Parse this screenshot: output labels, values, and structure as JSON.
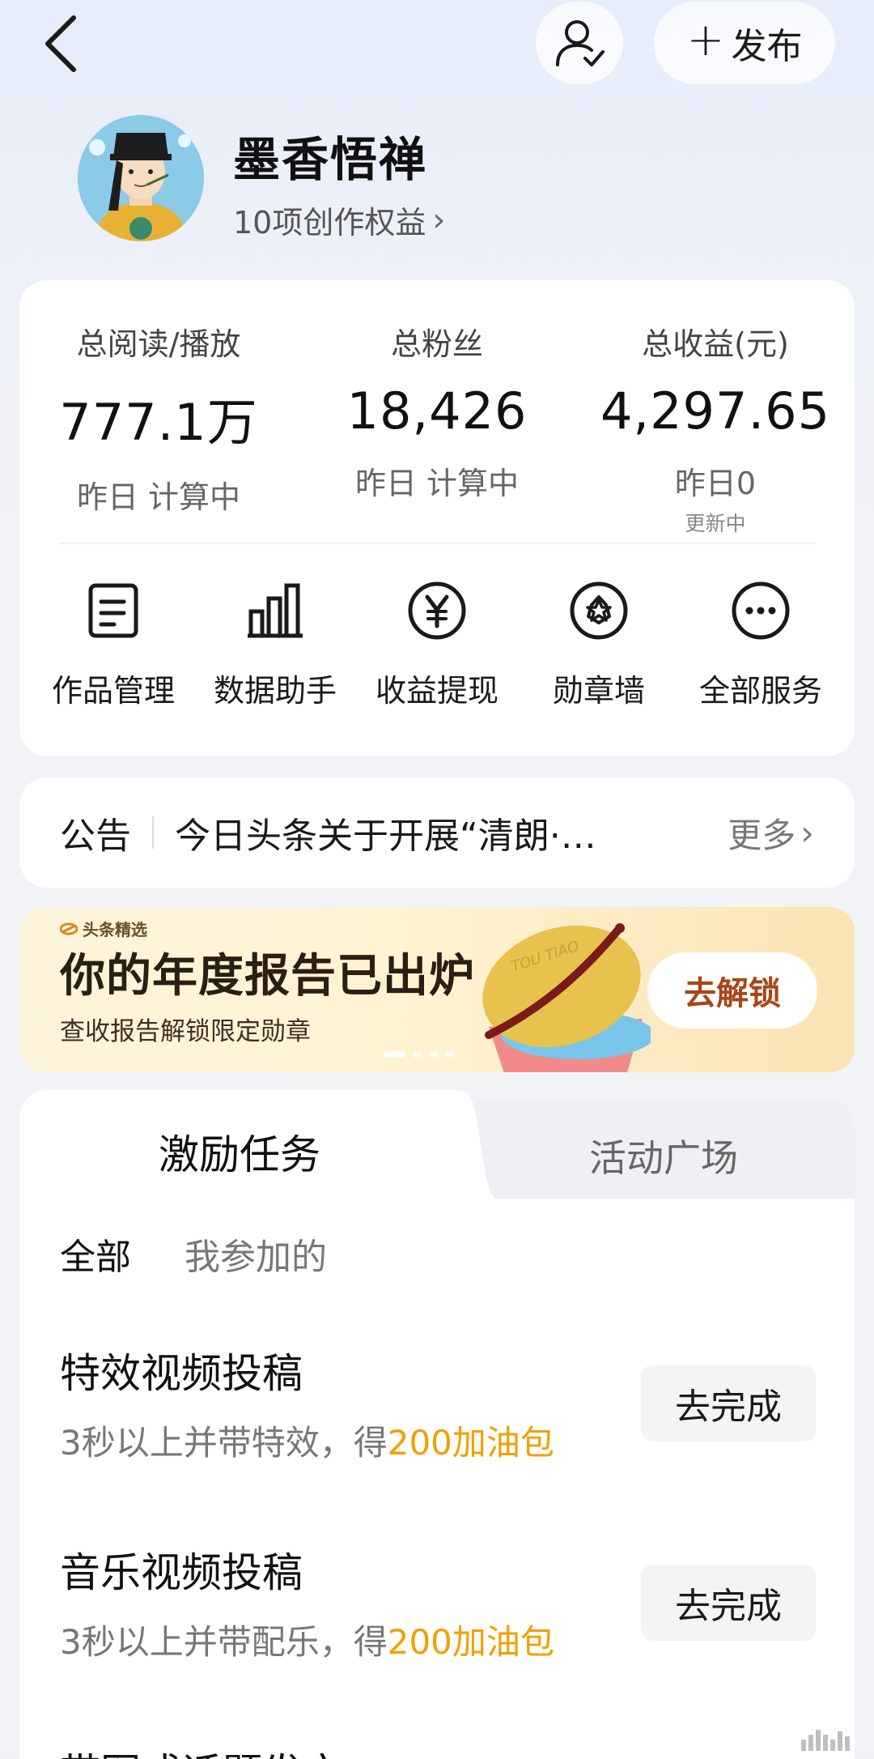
{
  "header": {
    "back_icon": "chevron-left-icon",
    "profile_icon": "user-check-icon",
    "publish_label": "发布"
  },
  "profile": {
    "name": "墨香悟禅",
    "rights_link": "10项创作权益"
  },
  "stats": [
    {
      "label": "总阅读/播放",
      "value": "777.1万",
      "sub": "昨日 计算中",
      "sub2": ""
    },
    {
      "label": "总粉丝",
      "value": "18,426",
      "sub": "昨日 计算中",
      "sub2": ""
    },
    {
      "label": "总收益(元)",
      "value": "4,297.65",
      "sub": "昨日0",
      "sub2": "更新中"
    }
  ],
  "services": [
    {
      "label": "作品管理",
      "icon": "document-icon"
    },
    {
      "label": "数据助手",
      "icon": "bar-chart-icon"
    },
    {
      "label": "收益提现",
      "icon": "yen-icon"
    },
    {
      "label": "勋章墙",
      "icon": "badge-icon"
    },
    {
      "label": "全部服务",
      "icon": "more-icon"
    }
  ],
  "announcement": {
    "tag": "公告",
    "text": "今日头条关于开展“清朗·…",
    "more": "更多"
  },
  "banner": {
    "brand": "头条精选",
    "title": "你的年度报告已出炉",
    "subtitle": "查收报告解锁限定勋章",
    "cta": "去解锁",
    "art_text": "TOU TIAO",
    "colors": {
      "cta_text": "#a8461a",
      "bg": "#fdf1d4"
    }
  },
  "tasks": {
    "tab_active": "激励任务",
    "tab_inactive": "活动广场",
    "filter_all": "全部",
    "filter_mine": "我参加的",
    "items": [
      {
        "title": "特效视频投稿",
        "desc_prefix": "3秒以上并带特效，得",
        "reward": "200加油包",
        "button": "去完成"
      },
      {
        "title": "音乐视频投稿",
        "desc_prefix": "3秒以上并带配乐，得",
        "reward": "200加油包",
        "button": "去完成"
      },
      {
        "title": "带图或话题发文"
      }
    ],
    "colors": {
      "reward": "#f0a000"
    }
  }
}
